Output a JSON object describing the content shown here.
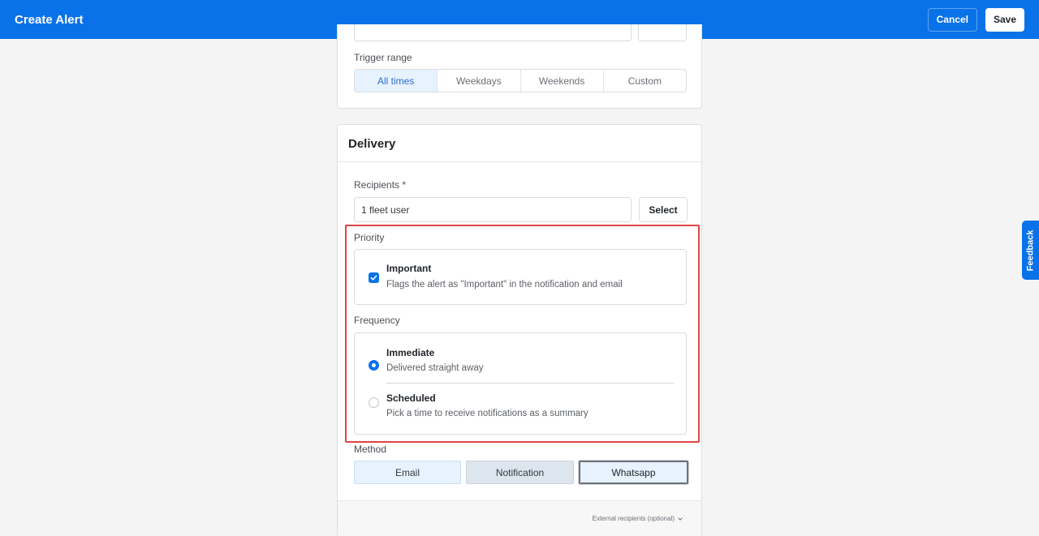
{
  "header": {
    "title": "Create Alert",
    "cancel_label": "Cancel",
    "save_label": "Save"
  },
  "trigger": {
    "label": "Trigger range",
    "options": [
      "All times",
      "Weekdays",
      "Weekends",
      "Custom"
    ],
    "selected": "All times"
  },
  "delivery": {
    "title": "Delivery",
    "recipients_label": "Recipients *",
    "recipients_value": "1 fleet user",
    "select_label": "Select",
    "priority": {
      "label": "Priority",
      "option_title": "Important",
      "option_desc": "Flags the alert as \"Important\" in the notification and email",
      "checked": true
    },
    "frequency": {
      "label": "Frequency",
      "options": [
        {
          "title": "Immediate",
          "desc": "Delivered straight away",
          "selected": true
        },
        {
          "title": "Scheduled",
          "desc": "Pick a time to receive notifications as a summary",
          "selected": false
        }
      ]
    },
    "method": {
      "label": "Method",
      "options": [
        "Email",
        "Notification",
        "Whatsapp"
      ]
    },
    "external_label": "External recipients (optional)"
  },
  "feedback_label": "Feedback",
  "colors": {
    "brand": "#0a72e8",
    "highlight": "#e04545"
  }
}
